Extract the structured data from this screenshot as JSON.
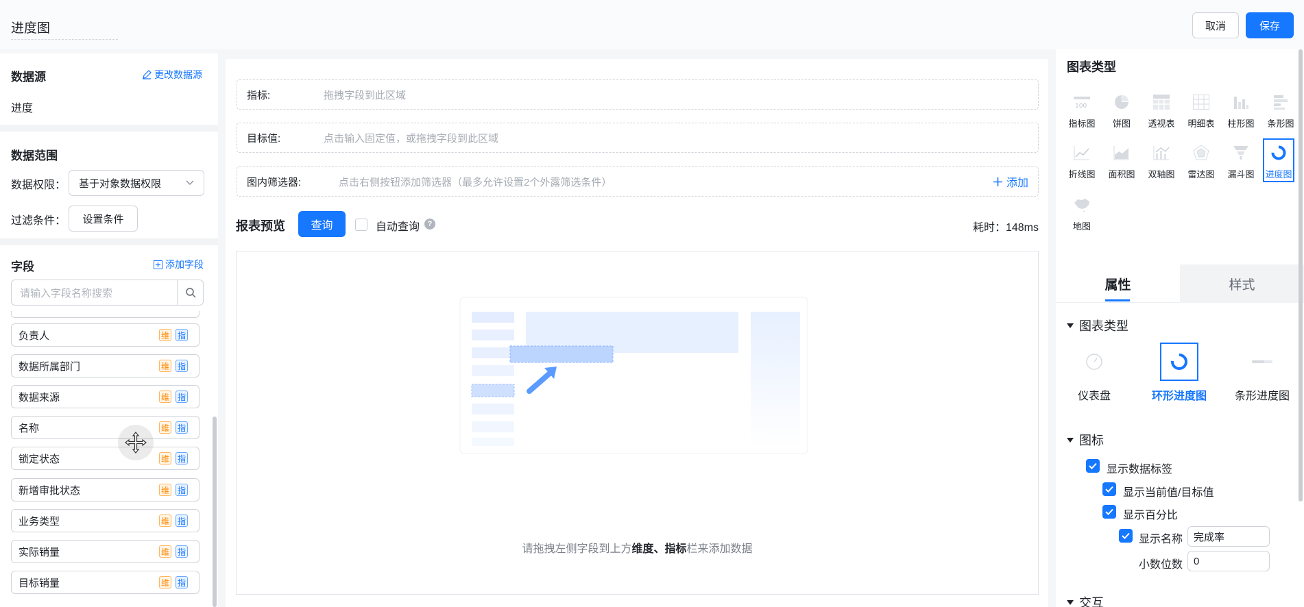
{
  "header": {
    "title": "进度图",
    "cancel_label": "取消",
    "save_label": "保存"
  },
  "left": {
    "datasource_title": "数据源",
    "change_datasource": "更改数据源",
    "datasource_name": "进度",
    "range_title": "数据范围",
    "permission_label": "数据权限：",
    "permission_value": "基于对象数据权限",
    "filter_label": "过滤条件：",
    "filter_button": "设置条件",
    "fields_title": "字段",
    "add_field": "添加字段",
    "search_placeholder": "请输入字段名称搜索",
    "dim_tag": "维",
    "metric_tag": "指",
    "fields": [
      "负责人",
      "数据所属部门",
      "数据来源",
      "名称",
      "锁定状态",
      "新增审批状态",
      "业务类型",
      "实际销量",
      "目标销量"
    ]
  },
  "center": {
    "metric_label": "指标:",
    "metric_hint": "拖拽字段到此区域",
    "target_label": "目标值:",
    "target_hint": "点击输入固定值，或拖拽字段到此区域",
    "filter_label": "图内筛选器:",
    "filter_hint": "点击右侧按钮添加筛选器（最多允许设置2个外露筛选条件）",
    "add_label": "添加",
    "preview_title": "报表预览",
    "query_button": "查询",
    "auto_query": "自动查询",
    "elapsed": "耗时：148ms",
    "empty_hint_prefix": "请拖拽左侧字段到上方",
    "empty_hint_bold": "维度、指标",
    "empty_hint_suffix": "栏来添加数据"
  },
  "right": {
    "chart_types_title": "图表类型",
    "chart_types": [
      "指标图",
      "饼图",
      "透视表",
      "明细表",
      "柱形图",
      "条形图",
      "折线图",
      "面积图",
      "双轴图",
      "雷达图",
      "漏斗图",
      "进度图",
      "地图"
    ],
    "selected_type": "进度图",
    "tab_props": "属性",
    "tab_style": "样式",
    "group_chart_type": "图表类型",
    "sub_types": [
      "仪表盘",
      "环形进度图",
      "条形进度图"
    ],
    "group_legend": "图标",
    "show_data_label": "显示数据标签",
    "show_current_target": "显示当前值/目标值",
    "show_percent": "显示百分比",
    "show_name": "显示名称",
    "name_value": "完成率",
    "decimal_label": "小数位数",
    "decimal_value": "0",
    "group_interaction": "交互"
  },
  "colors": {
    "primary": "#1677ff",
    "dim_tag": "#ff8800"
  }
}
